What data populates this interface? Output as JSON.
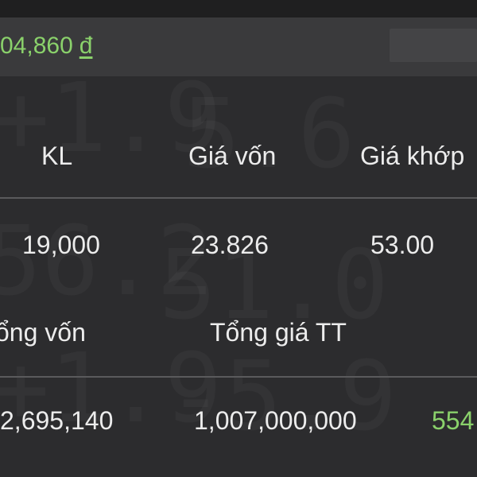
{
  "balance": {
    "value": "04,860",
    "currency_symbol": "đ"
  },
  "holdings_table": {
    "headers": {
      "quantity": "KL",
      "cost_price": "Giá vốn",
      "match_price": "Giá khớp"
    },
    "row": {
      "quantity": "19,000",
      "cost_price": "23.826",
      "match_price": "53.00"
    }
  },
  "totals_table": {
    "headers": {
      "total_cost": "ổng vốn",
      "total_market_value": "Tổng giá TT"
    },
    "row": {
      "total_cost": "2,695,140",
      "total_market_value": "1,007,000,000",
      "profit": "554"
    }
  },
  "colors": {
    "background": "#2c2c2e",
    "accent_green": "#8ad16b",
    "text": "#ececec",
    "divider": "#5a5a5c"
  }
}
